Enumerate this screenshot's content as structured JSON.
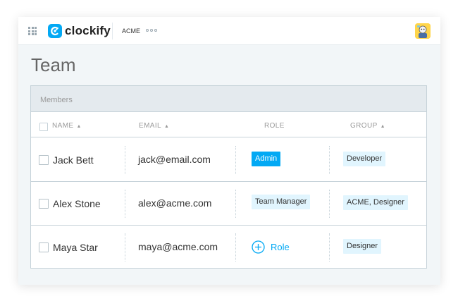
{
  "app": {
    "logo_text": "clockify",
    "workspace": "ACME",
    "brand_color": "#03a9f4"
  },
  "page": {
    "title": "Team"
  },
  "panel": {
    "header_label": "Members"
  },
  "table": {
    "columns": [
      {
        "label": "NAME",
        "sortable": true
      },
      {
        "label": "EMAIL",
        "sortable": true
      },
      {
        "label": "ROLE",
        "sortable": false
      },
      {
        "label": "GROUP",
        "sortable": true
      }
    ],
    "rows": [
      {
        "name": "Jack Bett",
        "email": "jack@email.com",
        "role": "Admin",
        "group": "Developer"
      },
      {
        "name": "Alex Stone",
        "email": "alex@acme.com",
        "role": "Team Manager",
        "group": "ACME, Designer"
      },
      {
        "name": "Maya Star",
        "email": "maya@acme.com",
        "role": "",
        "add_role_label": "Role",
        "group": "Designer"
      }
    ]
  },
  "icons": {
    "apps": "grid-icon",
    "more": "more-dots-icon",
    "sort": "sort-icon",
    "add": "plus-circle-icon"
  }
}
